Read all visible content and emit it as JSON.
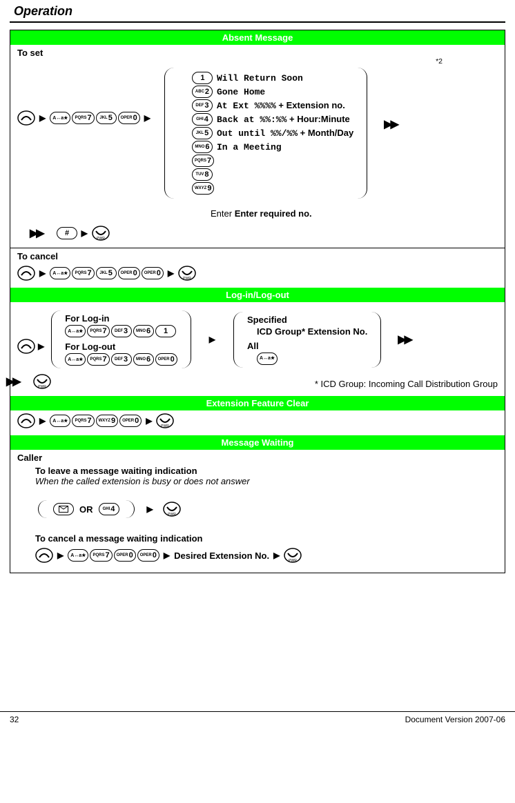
{
  "header": {
    "title": "Operation"
  },
  "sections": {
    "absent": {
      "title": "Absent Message",
      "to_set": "To set",
      "to_cancel": "To cancel",
      "star2": "*2",
      "enter_required": "Enter required no.",
      "messages": {
        "m1": "Will Return Soon",
        "m2": "Gone Home",
        "m3_code": "At Ext %%%%",
        "m3_suffix": " + Extension no.",
        "m4_code": "Back at %%:%%",
        "m4_suffix": " + Hour:Minute",
        "m5_code": "Out until %%/%%",
        "m5_suffix": " + Month/Day",
        "m6": "In a Meeting"
      }
    },
    "log": {
      "title": "Log-in/Log-out",
      "for_login": "For Log-in",
      "for_logout": "For Log-out",
      "specified": "Specified",
      "specified_sub": "ICD Group* Extension No.",
      "all": "All",
      "note": "* ICD Group: Incoming Call Distribution Group"
    },
    "ext_clear": {
      "title": "Extension Feature Clear"
    },
    "msg_wait": {
      "title": "Message Waiting",
      "caller": "Caller",
      "leave_title": "To leave a message waiting indication",
      "leave_sub": "When the called extension is busy or does not answer",
      "or": "OR",
      "cancel_title": "To cancel a message waiting indication",
      "desired_ext": "Desired Extension No."
    }
  },
  "footer": {
    "page": "32",
    "doc": "Document Version 2007-06"
  },
  "keys": {
    "star": "A↔a★",
    "pqrs7_l": "PQRS",
    "pqrs7_n": "7",
    "jkl5_l": "JKL",
    "jkl5_n": "5",
    "oper0_l": "OPER",
    "oper0_n": "0",
    "abc2_l": "ABC",
    "abc2_n": "2",
    "def3_l": "DEF",
    "def3_n": "3",
    "ghi4_l": "GHI",
    "ghi4_n": "4",
    "mno6_l": "MNO",
    "mno6_n": "6",
    "tuv8_l": "TUV",
    "tuv8_n": "8",
    "wxyz9_l": "WXYZ",
    "wxyz9_n": "9",
    "one": "1",
    "hash": "#",
    "pwr": "PWR"
  }
}
